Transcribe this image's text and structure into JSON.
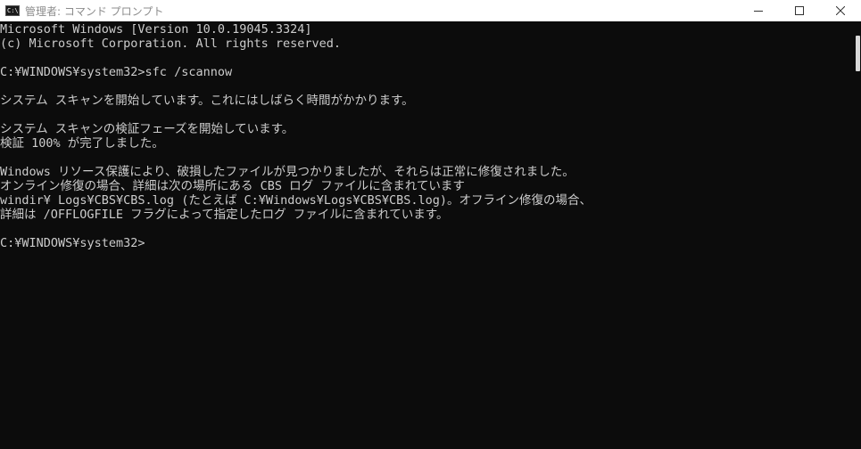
{
  "window": {
    "title": "管理者: コマンド プロンプト",
    "icon_text": "C:\\",
    "minimize_icon": "minimize-icon",
    "maximize_icon": "maximize-icon",
    "close_icon": "close-icon"
  },
  "console": {
    "lines": [
      "Microsoft Windows [Version 10.0.19045.3324]",
      "(c) Microsoft Corporation. All rights reserved.",
      "",
      "C:¥WINDOWS¥system32>sfc /scannow",
      "",
      "システム スキャンを開始しています。これにはしばらく時間がかかります。",
      "",
      "システム スキャンの検証フェーズを開始しています。",
      "検証 100% が完了しました。",
      "",
      "Windows リソース保護により、破損したファイルが見つかりましたが、それらは正常に修復されました。",
      "オンライン修復の場合、詳細は次の場所にある CBS ログ ファイルに含まれています",
      "windir¥ Logs¥CBS¥CBS.log (たとえば C:¥Windows¥Logs¥CBS¥CBS.log)。オフライン修復の場合、",
      "詳細は /OFFLOGFILE フラグによって指定したログ ファイルに含まれています。",
      "",
      "C:¥WINDOWS¥system32>"
    ]
  },
  "colors": {
    "console_background": "#0c0c0c",
    "console_text": "#cccccc",
    "titlebar_background": "#ffffff",
    "title_text": "#8c8c8c"
  }
}
